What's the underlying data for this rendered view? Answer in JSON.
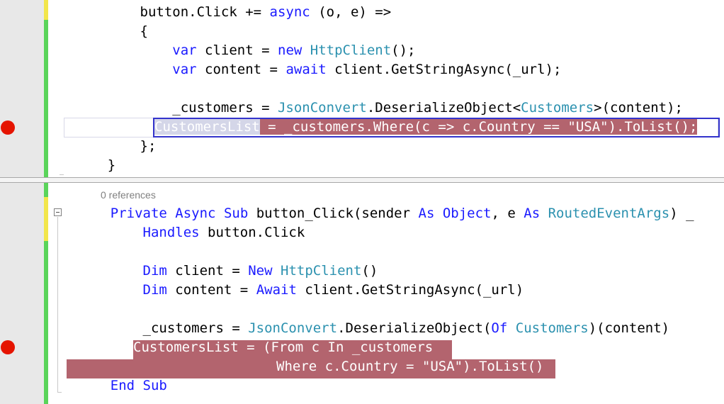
{
  "csharp_editor": {
    "lines": [
      [
        "        button.",
        "Click += ",
        {
          "k": "async"
        },
        " (o, e) =>"
      ],
      [
        "        {"
      ],
      [
        "            ",
        {
          "k": "var"
        },
        " client = ",
        {
          "k": "new"
        },
        " ",
        {
          "t": "HttpClient"
        },
        "();"
      ],
      [
        "            ",
        {
          "k": "var"
        },
        " content = ",
        {
          "k": "await"
        },
        " client.GetStringAsync(_url);"
      ],
      [
        ""
      ],
      [
        "            _customers = ",
        {
          "t": "JsonConvert"
        },
        ".DeserializeObject<",
        {
          "t": "Customers"
        },
        ">(content);"
      ],
      [
        "__HL__"
      ],
      [
        "        };"
      ],
      [
        "    }"
      ]
    ],
    "highlighted_statement": "CustomersList = _customers.Where(c => c.Country == \"USA\").ToList();",
    "breakpoint": true
  },
  "vb_editor": {
    "codelens": "0 references",
    "lines": [
      [
        "    ",
        {
          "k": "Private"
        },
        " ",
        {
          "k": "Async"
        },
        " ",
        {
          "k": "Sub"
        },
        " button_Click(sender ",
        {
          "k": "As"
        },
        " ",
        {
          "k": "Object"
        },
        ", e ",
        {
          "k": "As"
        },
        " ",
        {
          "t": "RoutedEventArgs"
        },
        ") _"
      ],
      [
        "        ",
        {
          "k": "Handles"
        },
        " button.Click"
      ],
      [
        ""
      ],
      [
        "        ",
        {
          "k": "Dim"
        },
        " client = ",
        {
          "k": "New"
        },
        " ",
        {
          "t": "HttpClient"
        },
        "()"
      ],
      [
        "        ",
        {
          "k": "Dim"
        },
        " content = ",
        {
          "k": "Await"
        },
        " client.GetStringAsync(_url)"
      ],
      [
        ""
      ],
      [
        "        _customers = ",
        {
          "t": "JsonConvert"
        },
        ".DeserializeObject(",
        {
          "k": "Of"
        },
        " ",
        {
          "t": "Customers"
        },
        ")(content)"
      ],
      [
        "__HL1__"
      ],
      [
        "__HL2__"
      ],
      [
        "    ",
        {
          "k": "End"
        },
        " ",
        {
          "k": "Sub"
        }
      ]
    ],
    "highlighted_line_1": "CustomersList = (From c In _customers",
    "highlighted_line_2": "Where c.Country = \"USA\").ToList()",
    "breakpoint": true
  },
  "colors": {
    "keyword": "#1a1aff",
    "type": "#2b91af",
    "string": "#a31515",
    "highlight": "#b3646e",
    "breakpoint": "#e51400",
    "changebar_saved": "#5ad45a",
    "changebar_unsaved": "#f2e64b"
  }
}
